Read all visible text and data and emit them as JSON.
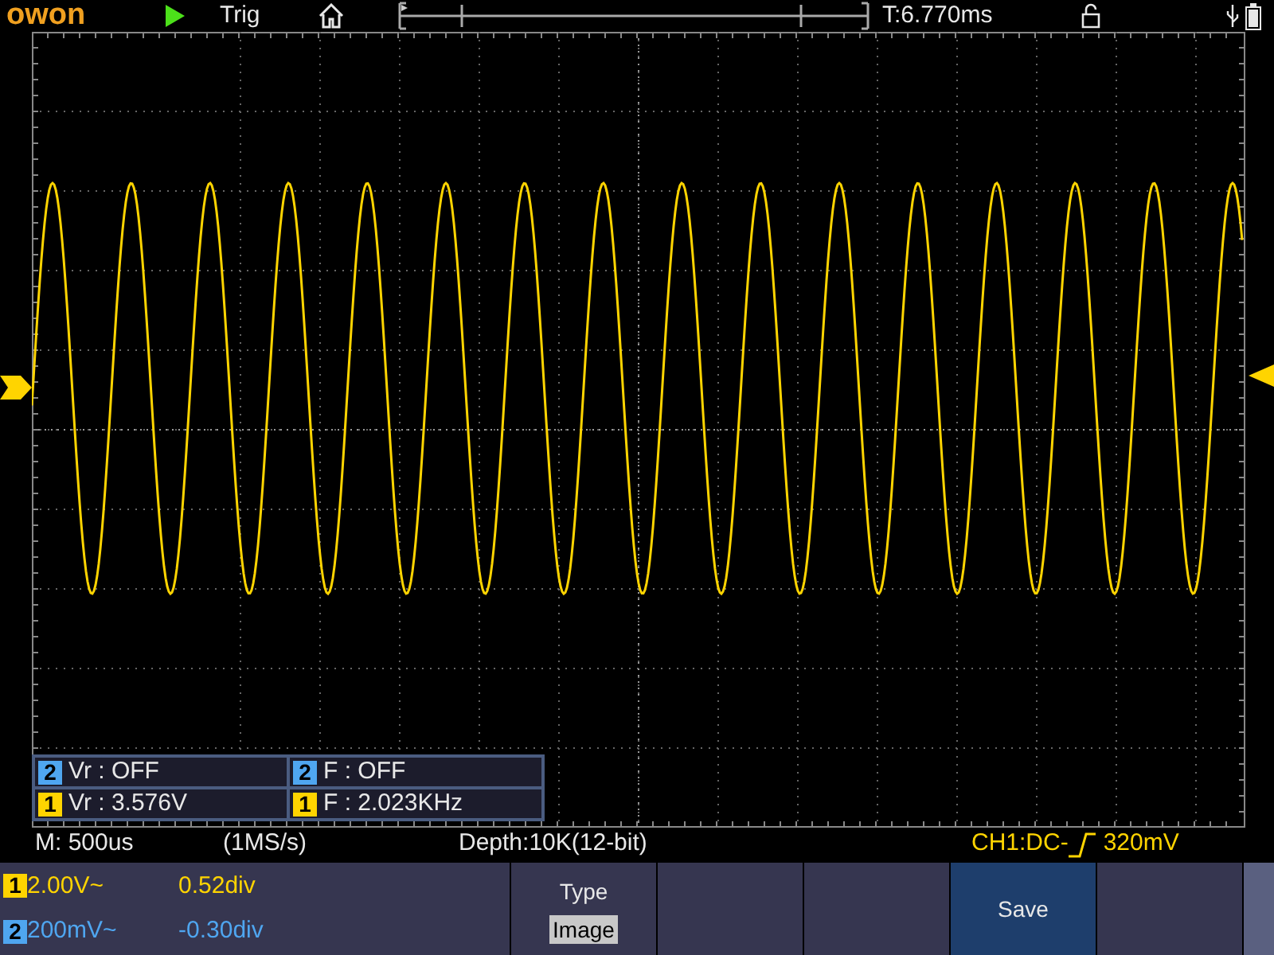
{
  "top_bar": {
    "brand": "owon",
    "trigger_status": "Trig",
    "trigger_time": "T:6.770ms"
  },
  "measurements": [
    {
      "channel": "2",
      "color": "#4fa6f0",
      "text": "Vr : OFF"
    },
    {
      "channel": "2",
      "color": "#4fa6f0",
      "text": "F : OFF"
    },
    {
      "channel": "1",
      "color": "#ffd400",
      "text": "Vr : 3.576V"
    },
    {
      "channel": "1",
      "color": "#ffd400",
      "text": "F : 2.023KHz"
    }
  ],
  "status_line": {
    "timebase": "M: 500us",
    "sample_rate": "(1MS/s)",
    "depth": "Depth:10K(12-bit)",
    "trigger_source": "CH1:DC-",
    "trigger_level": "320mV"
  },
  "channels": [
    {
      "number": "1",
      "color": "#ffd400",
      "scale": "2.00V~",
      "offset": "0.52div"
    },
    {
      "number": "2",
      "color": "#4fa6f0",
      "scale": "200mV~",
      "offset": "-0.30div"
    }
  ],
  "menu": [
    {
      "kind": "option",
      "title": "Type",
      "value": "Image",
      "selected": false
    },
    {
      "kind": "blank",
      "selected": false
    },
    {
      "kind": "blank",
      "selected": false
    },
    {
      "kind": "action",
      "title": "Save",
      "selected": true
    },
    {
      "kind": "blank",
      "selected": false
    }
  ]
}
